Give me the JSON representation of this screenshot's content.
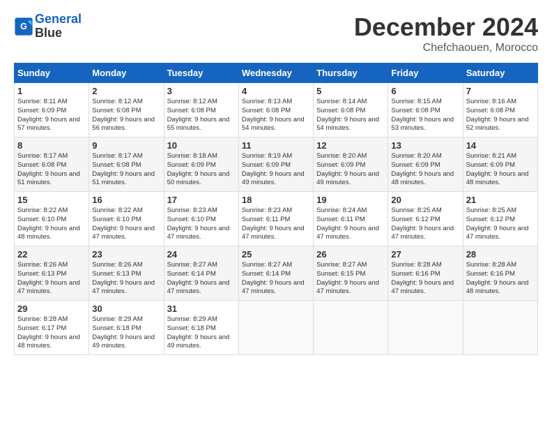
{
  "header": {
    "logo_line1": "General",
    "logo_line2": "Blue",
    "month": "December 2024",
    "location": "Chefchaouen, Morocco"
  },
  "weekdays": [
    "Sunday",
    "Monday",
    "Tuesday",
    "Wednesday",
    "Thursday",
    "Friday",
    "Saturday"
  ],
  "weeks": [
    [
      {
        "day": "1",
        "sunrise": "8:11 AM",
        "sunset": "6:09 PM",
        "daylight": "9 hours and 57 minutes."
      },
      {
        "day": "2",
        "sunrise": "8:12 AM",
        "sunset": "6:08 PM",
        "daylight": "9 hours and 56 minutes."
      },
      {
        "day": "3",
        "sunrise": "8:12 AM",
        "sunset": "6:08 PM",
        "daylight": "9 hours and 55 minutes."
      },
      {
        "day": "4",
        "sunrise": "8:13 AM",
        "sunset": "6:08 PM",
        "daylight": "9 hours and 54 minutes."
      },
      {
        "day": "5",
        "sunrise": "8:14 AM",
        "sunset": "6:08 PM",
        "daylight": "9 hours and 54 minutes."
      },
      {
        "day": "6",
        "sunrise": "8:15 AM",
        "sunset": "6:08 PM",
        "daylight": "9 hours and 53 minutes."
      },
      {
        "day": "7",
        "sunrise": "8:16 AM",
        "sunset": "6:08 PM",
        "daylight": "9 hours and 52 minutes."
      }
    ],
    [
      {
        "day": "8",
        "sunrise": "8:17 AM",
        "sunset": "6:08 PM",
        "daylight": "9 hours and 51 minutes."
      },
      {
        "day": "9",
        "sunrise": "8:17 AM",
        "sunset": "6:08 PM",
        "daylight": "9 hours and 51 minutes."
      },
      {
        "day": "10",
        "sunrise": "8:18 AM",
        "sunset": "6:09 PM",
        "daylight": "9 hours and 50 minutes."
      },
      {
        "day": "11",
        "sunrise": "8:19 AM",
        "sunset": "6:09 PM",
        "daylight": "9 hours and 49 minutes."
      },
      {
        "day": "12",
        "sunrise": "8:20 AM",
        "sunset": "6:09 PM",
        "daylight": "9 hours and 49 minutes."
      },
      {
        "day": "13",
        "sunrise": "8:20 AM",
        "sunset": "6:09 PM",
        "daylight": "9 hours and 48 minutes."
      },
      {
        "day": "14",
        "sunrise": "8:21 AM",
        "sunset": "6:09 PM",
        "daylight": "9 hours and 48 minutes."
      }
    ],
    [
      {
        "day": "15",
        "sunrise": "8:22 AM",
        "sunset": "6:10 PM",
        "daylight": "9 hours and 48 minutes."
      },
      {
        "day": "16",
        "sunrise": "8:22 AM",
        "sunset": "6:10 PM",
        "daylight": "9 hours and 47 minutes."
      },
      {
        "day": "17",
        "sunrise": "8:23 AM",
        "sunset": "6:10 PM",
        "daylight": "9 hours and 47 minutes."
      },
      {
        "day": "18",
        "sunrise": "8:23 AM",
        "sunset": "6:11 PM",
        "daylight": "9 hours and 47 minutes."
      },
      {
        "day": "19",
        "sunrise": "8:24 AM",
        "sunset": "6:11 PM",
        "daylight": "9 hours and 47 minutes."
      },
      {
        "day": "20",
        "sunrise": "8:25 AM",
        "sunset": "6:12 PM",
        "daylight": "9 hours and 47 minutes."
      },
      {
        "day": "21",
        "sunrise": "8:25 AM",
        "sunset": "6:12 PM",
        "daylight": "9 hours and 47 minutes."
      }
    ],
    [
      {
        "day": "22",
        "sunrise": "8:26 AM",
        "sunset": "6:13 PM",
        "daylight": "9 hours and 47 minutes."
      },
      {
        "day": "23",
        "sunrise": "8:26 AM",
        "sunset": "6:13 PM",
        "daylight": "9 hours and 47 minutes."
      },
      {
        "day": "24",
        "sunrise": "8:27 AM",
        "sunset": "6:14 PM",
        "daylight": "9 hours and 47 minutes."
      },
      {
        "day": "25",
        "sunrise": "8:27 AM",
        "sunset": "6:14 PM",
        "daylight": "9 hours and 47 minutes."
      },
      {
        "day": "26",
        "sunrise": "8:27 AM",
        "sunset": "6:15 PM",
        "daylight": "9 hours and 47 minutes."
      },
      {
        "day": "27",
        "sunrise": "8:28 AM",
        "sunset": "6:16 PM",
        "daylight": "9 hours and 47 minutes."
      },
      {
        "day": "28",
        "sunrise": "8:28 AM",
        "sunset": "6:16 PM",
        "daylight": "9 hours and 48 minutes."
      }
    ],
    [
      {
        "day": "29",
        "sunrise": "8:28 AM",
        "sunset": "6:17 PM",
        "daylight": "9 hours and 48 minutes."
      },
      {
        "day": "30",
        "sunrise": "8:29 AM",
        "sunset": "6:18 PM",
        "daylight": "9 hours and 49 minutes."
      },
      {
        "day": "31",
        "sunrise": "8:29 AM",
        "sunset": "6:18 PM",
        "daylight": "9 hours and 49 minutes."
      },
      null,
      null,
      null,
      null
    ]
  ]
}
